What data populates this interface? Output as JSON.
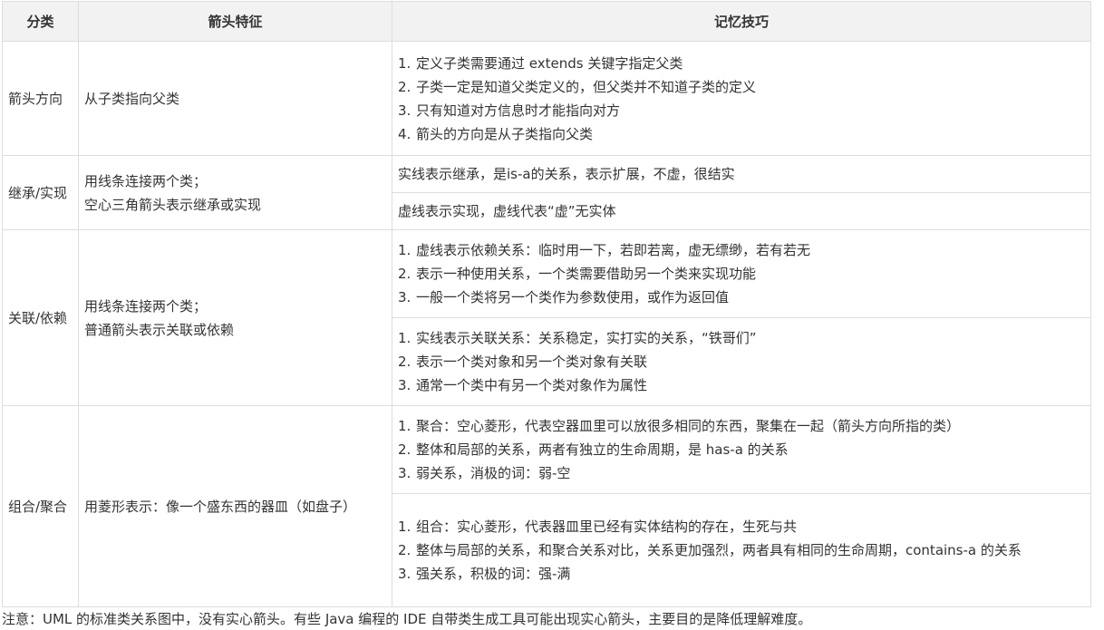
{
  "headers": [
    "分类",
    "箭头特征",
    "记忆技巧"
  ],
  "rows": {
    "arrow": {
      "category": "箭头方向",
      "feature": "从子类指向父类",
      "tips": [
        "定义子类需要通过 extends 关键字指定父类",
        "子类一定是知道父类定义的，但父类并不知道子类的定义",
        "只有知道对方信息时才能指向对方",
        "箭头的方向是从子类指向父类"
      ]
    },
    "inherit": {
      "category": "继承/实现",
      "feature_lines": [
        "用线条连接两个类；",
        "空心三角箭头表示继承或实现"
      ],
      "tip_a": "实线表示继承，是is-a的关系，表示扩展，不虚，很结实",
      "tip_b": "虚线表示实现，虚线代表“虚”无实体"
    },
    "assoc": {
      "category": "关联/依赖",
      "feature_lines": [
        "用线条连接两个类；",
        "普通箭头表示关联或依赖"
      ],
      "tips_a": [
        "虚线表示依赖关系：临时用一下，若即若离，虚无缥缈，若有若无",
        "表示一种使用关系，一个类需要借助另一个类来实现功能",
        "一般一个类将另一个类作为参数使用，或作为返回值"
      ],
      "tips_b": [
        "实线表示关联关系：关系稳定，实打实的关系，“铁哥们”",
        "表示一个类对象和另一个类对象有关联",
        "通常一个类中有另一个类对象作为属性"
      ]
    },
    "compose": {
      "category": "组合/聚合",
      "feature": "用菱形表示：像一个盛东西的器皿（如盘子）",
      "tips_a": [
        "聚合：空心菱形，代表空器皿里可以放很多相同的东西，聚集在一起（箭头方向所指的类）",
        "整体和局部的关系，两者有独立的生命周期，是 has-a 的关系",
        "弱关系，消极的词：弱-空"
      ],
      "tips_b": [
        "组合：实心菱形，代表器皿里已经有实体结构的存在，生死与共",
        "整体与局部的关系，和聚合关系对比，关系更加强烈，两者具有相同的生命周期，contains-a 的关系",
        "强关系，积极的词：强-满"
      ]
    }
  },
  "numbers": [
    "1.",
    "2.",
    "3.",
    "4."
  ],
  "note": "注意：UML 的标准类关系图中，没有实心箭头。有些 Java 编程的 IDE 自带类生成工具可能出现实心箭头，主要目的是降低理解难度。"
}
